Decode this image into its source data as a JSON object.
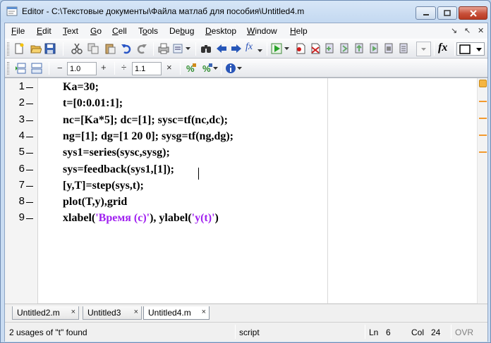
{
  "window": {
    "title": "Editor - C:\\Текстовые документы\\Файла матлаб для пособия\\Untitled4.m"
  },
  "menu": [
    {
      "label": "File",
      "key": "F",
      "rest": "ile"
    },
    {
      "label": "Edit",
      "key": "E",
      "rest": "dit"
    },
    {
      "label": "Text",
      "key": "T",
      "rest": "ext"
    },
    {
      "label": "Go",
      "key": "G",
      "rest": "o"
    },
    {
      "label": "Cell",
      "key": "C",
      "rest": "ell"
    },
    {
      "label": "Tools",
      "key": "o",
      "pre": "T",
      "rest": "ols"
    },
    {
      "label": "Debug",
      "key": "b",
      "pre": "De",
      "rest": "ug"
    },
    {
      "label": "Desktop",
      "key": "D",
      "rest": "esktop"
    },
    {
      "label": "Window",
      "key": "W",
      "rest": "indow"
    },
    {
      "label": "Help",
      "key": "H",
      "rest": "elp"
    }
  ],
  "menu_controls": {
    "dock": "↘",
    "undock": "↖",
    "close": "✕"
  },
  "toolbar2": {
    "minus": "−",
    "cell_step_1": "1.0",
    "plus": "+",
    "divide": "÷",
    "cell_step_2": "1.1",
    "times": "×"
  },
  "fx_label": "fx",
  "code_lines": [
    {
      "num": "1",
      "text": "Ka=30;"
    },
    {
      "num": "2",
      "text": "t=[0:0.01:1];"
    },
    {
      "num": "3",
      "text": "nc=[Ka*5]; dc=[1]; sysc=tf(nc,dc);"
    },
    {
      "num": "4",
      "text": "ng=[1]; dg=[1 20 0]; sysg=tf(ng,dg);"
    },
    {
      "num": "5",
      "text": "sys1=series(sysc,sysg);"
    },
    {
      "num": "6",
      "text": "sys=feedback(sys1,[1]);"
    },
    {
      "num": "7",
      "text": "[y,T]=step(sys,t);"
    },
    {
      "num": "8",
      "text": "plot(T,y),grid"
    },
    {
      "num": "9",
      "text": "xlabel('Время (с)'), ylabel('y(t)')",
      "parts": [
        "xlabel(",
        "'Время (с)'",
        "), ylabel(",
        "'y(t)'",
        ")"
      ]
    }
  ],
  "tabs": [
    {
      "label": "Untitled2.m",
      "close": "×"
    },
    {
      "label": "Untitled3",
      "close": "×"
    },
    {
      "label": "Untitled4.m",
      "close": "×",
      "active": true
    }
  ],
  "status": {
    "message": "2 usages of \"t\" found",
    "mode": "script",
    "ln_label": "Ln",
    "ln_value": "6",
    "col_label": "Col",
    "col_value": "24",
    "ovr": "OVR"
  },
  "colors": {
    "string": "#a020f0",
    "warning_mark": "#f29a2f"
  }
}
